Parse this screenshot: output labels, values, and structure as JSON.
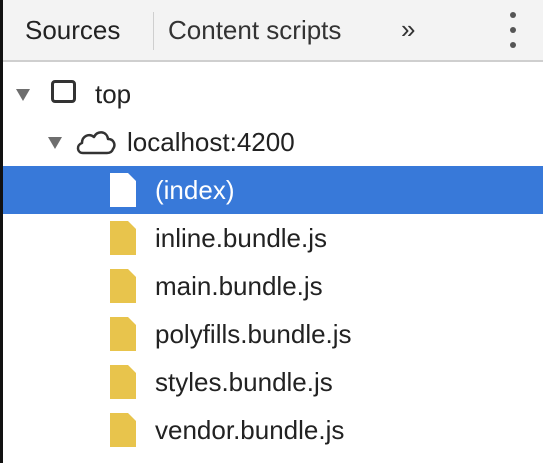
{
  "tabs": {
    "sources_label": "Sources",
    "content_scripts_label": "Content scripts",
    "more_label": "»"
  },
  "tree": {
    "frame": {
      "label": "top",
      "expanded": true,
      "icon": "frame-icon"
    },
    "origin": {
      "label": "localhost:4200",
      "expanded": true,
      "icon": "cloud-icon"
    },
    "files": [
      {
        "label": "(index)",
        "selected": true,
        "icon": "document-icon"
      },
      {
        "label": "inline.bundle.js",
        "selected": false,
        "icon": "script-file-icon"
      },
      {
        "label": "main.bundle.js",
        "selected": false,
        "icon": "script-file-icon"
      },
      {
        "label": "polyfills.bundle.js",
        "selected": false,
        "icon": "script-file-icon"
      },
      {
        "label": "styles.bundle.js",
        "selected": false,
        "icon": "script-file-icon"
      },
      {
        "label": "vendor.bundle.js",
        "selected": false,
        "icon": "script-file-icon"
      }
    ]
  },
  "colors": {
    "selection": "#3879d9",
    "script_file": "#e8c44c",
    "tabbar_background": "#f3f3f3"
  }
}
